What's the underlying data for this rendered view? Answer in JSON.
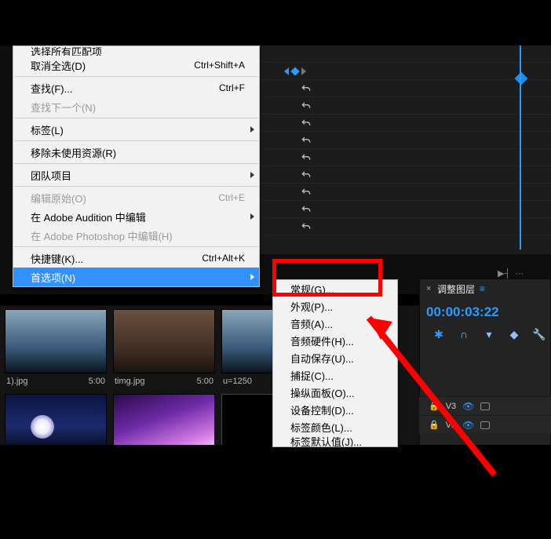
{
  "context_menu": {
    "items": [
      {
        "label": "选择所有匹配项",
        "shortcut": "",
        "disabled": false,
        "peek": true
      },
      {
        "label": "取消全选(D)",
        "shortcut": "Ctrl+Shift+A"
      },
      {
        "sep": true
      },
      {
        "label": "查找(F)...",
        "shortcut": "Ctrl+F"
      },
      {
        "label": "查找下一个(N)",
        "shortcut": "",
        "disabled": true
      },
      {
        "sep": true
      },
      {
        "label": "标签(L)",
        "submenu": true
      },
      {
        "sep": true
      },
      {
        "label": "移除未使用资源(R)"
      },
      {
        "sep": true
      },
      {
        "label": "团队项目",
        "submenu": true
      },
      {
        "sep": true
      },
      {
        "label": "编辑原始(O)",
        "shortcut": "Ctrl+E",
        "disabled": true
      },
      {
        "label": "在 Adobe Audition 中编辑",
        "submenu": true
      },
      {
        "label": "在 Adobe Photoshop 中编辑(H)",
        "disabled": true
      },
      {
        "sep": true
      },
      {
        "label": "快捷键(K)...",
        "shortcut": "Ctrl+Alt+K"
      },
      {
        "label": "首选项(N)",
        "submenu": true,
        "highlight": true
      }
    ]
  },
  "submenu": {
    "items": [
      {
        "label": "常规(G)..."
      },
      {
        "label": "外观(P)..."
      },
      {
        "label": "音频(A)..."
      },
      {
        "label": "音频硬件(H)..."
      },
      {
        "label": "自动保存(U)..."
      },
      {
        "label": "捕捉(C)..."
      },
      {
        "label": "操纵面板(O)..."
      },
      {
        "label": "设备控制(D)..."
      },
      {
        "label": "标签颜色(L)..."
      },
      {
        "label": "标签默认值(J)..."
      }
    ]
  },
  "panel": {
    "tab_title": "调整图层",
    "tab_mark": "≡",
    "timecode": "00:00:03:22",
    "layers": [
      {
        "name": "V3"
      },
      {
        "name": "V2"
      }
    ]
  },
  "media": {
    "thumbs": [
      {
        "name": "1).jpg",
        "dur": "5:00",
        "cls": "sky1"
      },
      {
        "name": "timg.jpg",
        "dur": "5:00",
        "cls": "room"
      },
      {
        "name": "u=1250",
        "dur": "",
        "cls": "sky1"
      }
    ],
    "thumbs2": [
      {
        "name": "",
        "dur": "",
        "cls": "moon-night"
      },
      {
        "name": "",
        "dur": "",
        "cls": "blossom"
      },
      {
        "name": "",
        "dur": "",
        "cls": "black-thumb"
      }
    ]
  }
}
